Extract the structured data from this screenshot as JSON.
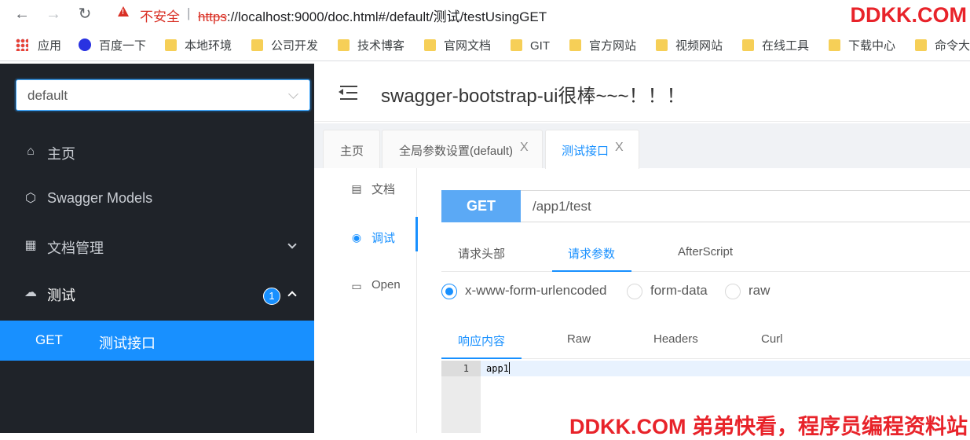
{
  "browser": {
    "insecure_label": "不安全",
    "separator": "|",
    "url_scheme": "https",
    "url_rest": "://localhost:9000/doc.html#/default/测试/testUsingGET",
    "watermark": "DDKK.COM",
    "bookmarks": [
      {
        "label": "应用",
        "icon": "apps-grid-icon"
      },
      {
        "label": "百度一下",
        "icon": "baidu-icon"
      },
      {
        "label": "本地环境",
        "icon": "folder-icon"
      },
      {
        "label": "公司开发",
        "icon": "folder-icon"
      },
      {
        "label": "技术博客",
        "icon": "folder-icon"
      },
      {
        "label": "官网文档",
        "icon": "folder-icon"
      },
      {
        "label": "GIT",
        "icon": "folder-icon"
      },
      {
        "label": "官方网站",
        "icon": "folder-icon"
      },
      {
        "label": "视频网站",
        "icon": "folder-icon"
      },
      {
        "label": "在线工具",
        "icon": "folder-icon"
      },
      {
        "label": "下载中心",
        "icon": "folder-icon"
      },
      {
        "label": "命令大",
        "icon": "folder-icon"
      }
    ]
  },
  "sidebar": {
    "group_select": "default",
    "items": [
      {
        "label": "主页",
        "icon": "home-icon"
      },
      {
        "label": "Swagger Models",
        "icon": "cube-icon"
      },
      {
        "label": "文档管理",
        "icon": "doc-settings-icon"
      },
      {
        "label": "测试",
        "icon": "cloud-icon",
        "badge": "1"
      }
    ],
    "active_sub": {
      "method": "GET",
      "name": "测试接口"
    }
  },
  "header": {
    "title": "swagger-bootstrap-ui很棒~~~！！！"
  },
  "tabs": [
    {
      "label": "主页",
      "closable": false
    },
    {
      "label": "全局参数设置(default)",
      "closable": true,
      "close": "X"
    },
    {
      "label": "测试接口",
      "closable": true,
      "close": "X",
      "active": true
    }
  ],
  "side_tabs": [
    {
      "label": "文档",
      "icon": "document-icon"
    },
    {
      "label": "调试",
      "icon": "bug-icon",
      "active": true
    },
    {
      "label": "Open",
      "icon": "file-icon"
    }
  ],
  "request": {
    "method": "GET",
    "path": "/app1/test",
    "tabs": [
      "请求头部",
      "请求参数",
      "AfterScript"
    ],
    "active_tab": "请求参数",
    "content_types": [
      "x-www-form-urlencoded",
      "form-data",
      "raw"
    ],
    "selected_content_type": "x-www-form-urlencoded"
  },
  "response": {
    "tabs": [
      "响应内容",
      "Raw",
      "Headers",
      "Curl"
    ],
    "active_tab": "响应内容",
    "line_number": "1",
    "code": "app1"
  },
  "footer_watermark": "DDKK.COM 弟弟快看，程序员编程资料站",
  "colors": {
    "accent": "#1890ff",
    "sidebar_bg": "#1f2329",
    "get_button": "#5ba9f5",
    "watermark": "#e8232a"
  }
}
